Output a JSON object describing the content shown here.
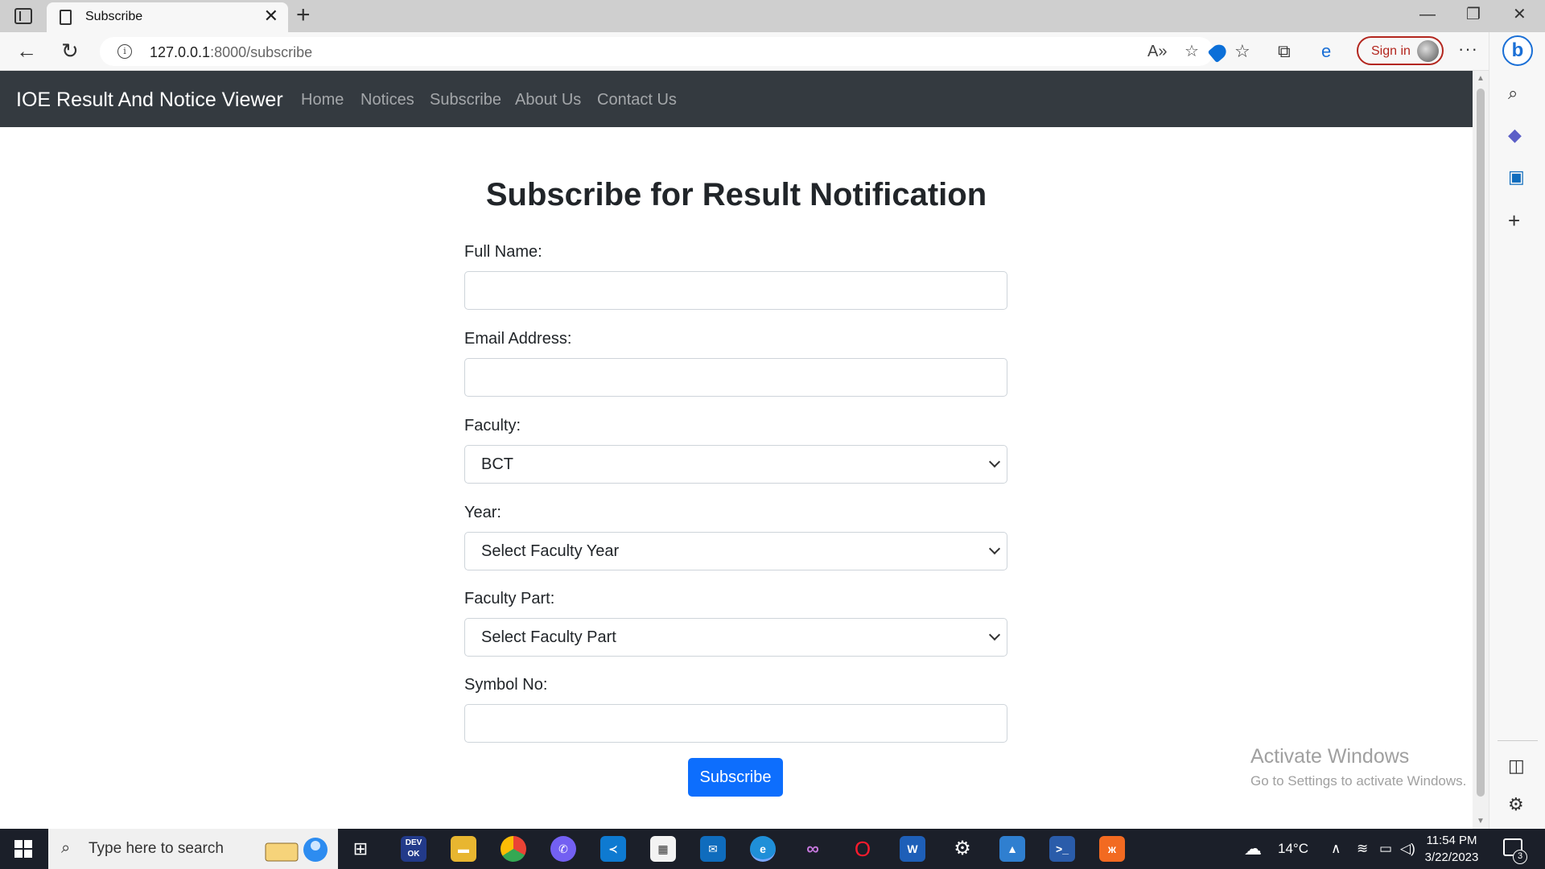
{
  "browser": {
    "tab_title": "Subscribe",
    "url_host": "127.0.0.1",
    "url_path": ":8000/subscribe",
    "signin_label": "Sign in"
  },
  "navbar": {
    "brand": "IOE Result And Notice Viewer",
    "links": [
      "Home",
      "Notices",
      "Subscribe",
      "About Us",
      "Contact Us"
    ]
  },
  "form": {
    "title": "Subscribe for Result Notification",
    "full_name_label": "Full Name:",
    "full_name_value": "",
    "email_label": "Email Address:",
    "email_value": "",
    "faculty_label": "Faculty:",
    "faculty_selected": "BCT",
    "year_label": "Year:",
    "year_selected": "Select Faculty Year",
    "part_label": "Faculty Part:",
    "part_selected": "Select Faculty Part",
    "symbol_label": "Symbol No:",
    "symbol_value": "",
    "submit_label": "Subscribe"
  },
  "watermark": {
    "title": "Activate Windows",
    "subtitle": "Go to Settings to activate Windows."
  },
  "taskbar": {
    "search_placeholder": "Type here to search",
    "apps": [
      "task-view",
      "devtoys",
      "file-explorer",
      "chrome",
      "viber",
      "vscode",
      "store",
      "mail",
      "edge",
      "visual-studio",
      "opera",
      "word",
      "settings",
      "photos",
      "powershell",
      "xampp"
    ],
    "weather": "14°C",
    "time": "11:54 PM",
    "date": "3/22/2023",
    "notification_count": "3"
  },
  "colors": {
    "navbar_bg": "#343a40",
    "primary": "#0d6efd",
    "signin_border": "#b3261e"
  }
}
